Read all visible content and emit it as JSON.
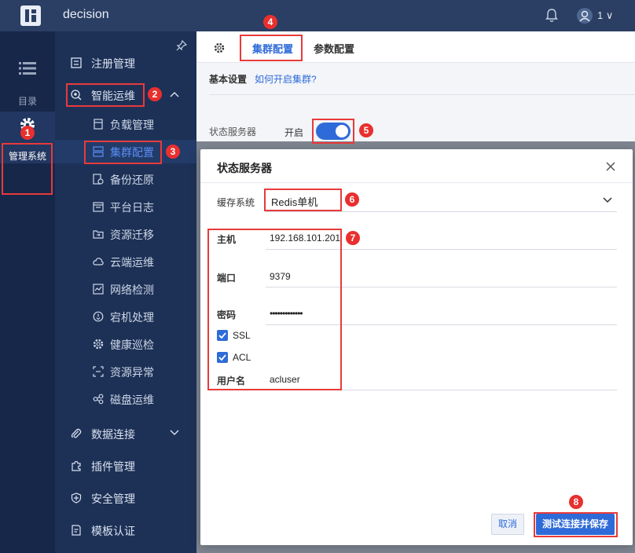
{
  "app": {
    "title": "decision",
    "user": "1"
  },
  "rail": {
    "catalog_label": "目录",
    "admin_label": "管理系统"
  },
  "nav": {
    "items": [
      {
        "label": "注册管理"
      },
      {
        "label": "智能运维"
      },
      {
        "label": "数据连接"
      },
      {
        "label": "插件管理"
      },
      {
        "label": "安全管理"
      },
      {
        "label": "模板认证"
      }
    ],
    "sub_items": [
      {
        "label": "负载管理"
      },
      {
        "label": "集群配置"
      },
      {
        "label": "备份还原"
      },
      {
        "label": "平台日志"
      },
      {
        "label": "资源迁移"
      },
      {
        "label": "云端运维"
      },
      {
        "label": "网络检测"
      },
      {
        "label": "宕机处理"
      },
      {
        "label": "健康巡检"
      },
      {
        "label": "资源异常"
      },
      {
        "label": "磁盘运维"
      }
    ]
  },
  "tabs": [
    {
      "label": "集群配置"
    },
    {
      "label": "参数配置"
    }
  ],
  "subheader": {
    "title": "基本设置",
    "link": "如何开启集群?"
  },
  "state_server": {
    "label": "状态服务器",
    "value": "开启",
    "enabled": true
  },
  "modal": {
    "title": "状态服务器",
    "cache_label": "缓存系统",
    "cache_value": "Redis单机",
    "host_label": "主机",
    "host_value": "192.168.101.201",
    "port_label": "端口",
    "port_value": "9379",
    "password_label": "密码",
    "password_value": "•••••••••••••",
    "ssl_label": "SSL",
    "ssl_checked": true,
    "acl_label": "ACL",
    "acl_checked": true,
    "username_label": "用户名",
    "username_value": "acluser",
    "cancel_label": "取消",
    "save_label": "测试连接并保存"
  },
  "callouts": [
    "1",
    "2",
    "3",
    "4",
    "5",
    "6",
    "7",
    "8"
  ],
  "colors": {
    "accent": "#2f6bd8",
    "callout": "#e8302e",
    "nav_bg": "#1d3157",
    "rail_bg": "#16274a"
  }
}
